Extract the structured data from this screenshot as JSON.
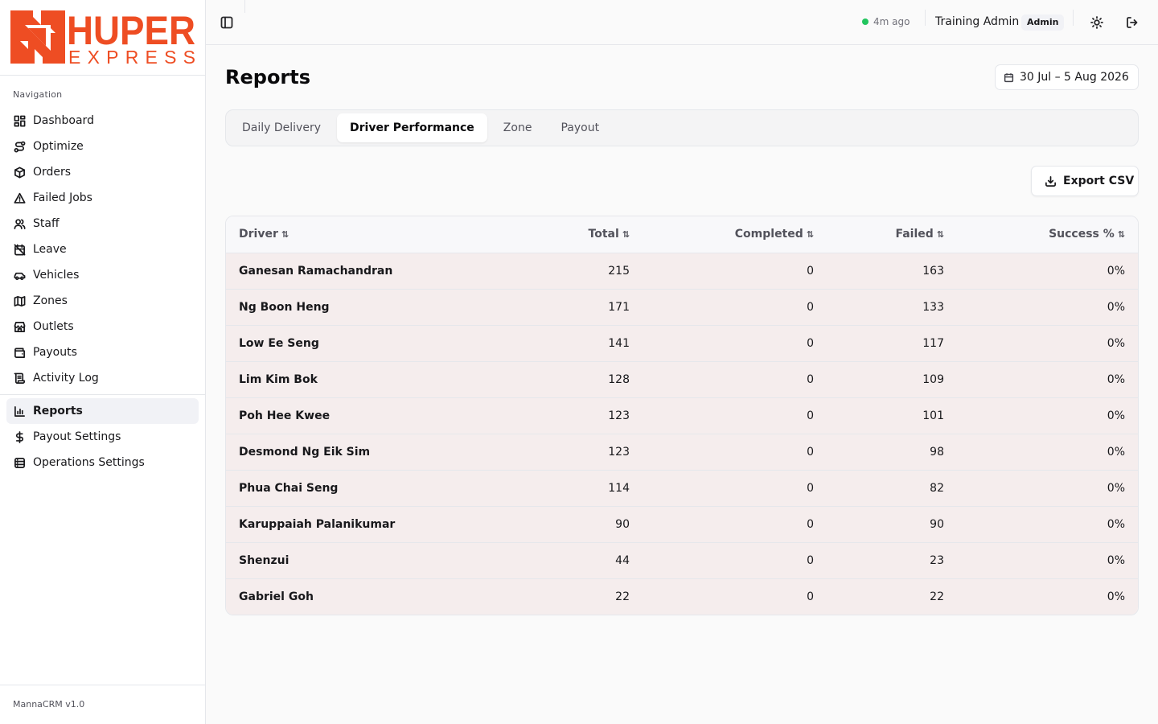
{
  "brand": {
    "logo_primary": "HUPER",
    "logo_secondary": "EXPRESS",
    "logo_color": "#ee4d23"
  },
  "sidebar": {
    "section_label": "Navigation",
    "items": [
      {
        "label": "Dashboard",
        "icon": "dashboard-icon"
      },
      {
        "label": "Optimize",
        "icon": "route-icon"
      },
      {
        "label": "Orders",
        "icon": "package-icon"
      },
      {
        "label": "Failed Jobs",
        "icon": "warning-icon"
      },
      {
        "label": "Staff",
        "icon": "users-icon"
      },
      {
        "label": "Leave",
        "icon": "calendar-off-icon"
      },
      {
        "label": "Vehicles",
        "icon": "car-icon"
      },
      {
        "label": "Zones",
        "icon": "map-icon"
      },
      {
        "label": "Outlets",
        "icon": "store-icon"
      },
      {
        "label": "Payouts",
        "icon": "wallet-icon"
      },
      {
        "label": "Activity Log",
        "icon": "scroll-icon"
      }
    ],
    "secondary_items": [
      {
        "label": "Reports",
        "icon": "bar-chart-icon",
        "active": true
      },
      {
        "label": "Payout Settings",
        "icon": "dollar-icon"
      },
      {
        "label": "Operations Settings",
        "icon": "database-icon"
      }
    ],
    "footer": "MannaCRM v1.0"
  },
  "topbar": {
    "status_text": "4m ago",
    "status_color": "#22c55e",
    "user_name": "Training Admin",
    "role": "Admin"
  },
  "page": {
    "title": "Reports",
    "date_range": "30 Jul – 5 Aug 2026",
    "tabs": [
      {
        "label": "Daily Delivery"
      },
      {
        "label": "Driver Performance",
        "active": true
      },
      {
        "label": "Zone"
      },
      {
        "label": "Payout"
      }
    ],
    "export_label": "Export CSV"
  },
  "table": {
    "columns": [
      "Driver",
      "Total",
      "Completed",
      "Failed",
      "Success %"
    ],
    "rows": [
      {
        "driver": "Ganesan Ramachandran",
        "total": "215",
        "completed": "0",
        "failed": "163",
        "success": "0%"
      },
      {
        "driver": "Ng Boon Heng",
        "total": "171",
        "completed": "0",
        "failed": "133",
        "success": "0%"
      },
      {
        "driver": "Low Ee Seng",
        "total": "141",
        "completed": "0",
        "failed": "117",
        "success": "0%"
      },
      {
        "driver": "Lim Kim Bok",
        "total": "128",
        "completed": "0",
        "failed": "109",
        "success": "0%"
      },
      {
        "driver": "Poh Hee Kwee",
        "total": "123",
        "completed": "0",
        "failed": "101",
        "success": "0%"
      },
      {
        "driver": "Desmond Ng Eik Sim",
        "total": "123",
        "completed": "0",
        "failed": "98",
        "success": "0%"
      },
      {
        "driver": "Phua Chai Seng",
        "total": "114",
        "completed": "0",
        "failed": "82",
        "success": "0%"
      },
      {
        "driver": "Karuppaiah Palanikumar",
        "total": "90",
        "completed": "0",
        "failed": "90",
        "success": "0%"
      },
      {
        "driver": "Shenzui",
        "total": "44",
        "completed": "0",
        "failed": "23",
        "success": "0%"
      },
      {
        "driver": "Gabriel Goh",
        "total": "22",
        "completed": "0",
        "failed": "22",
        "success": "0%"
      }
    ]
  }
}
